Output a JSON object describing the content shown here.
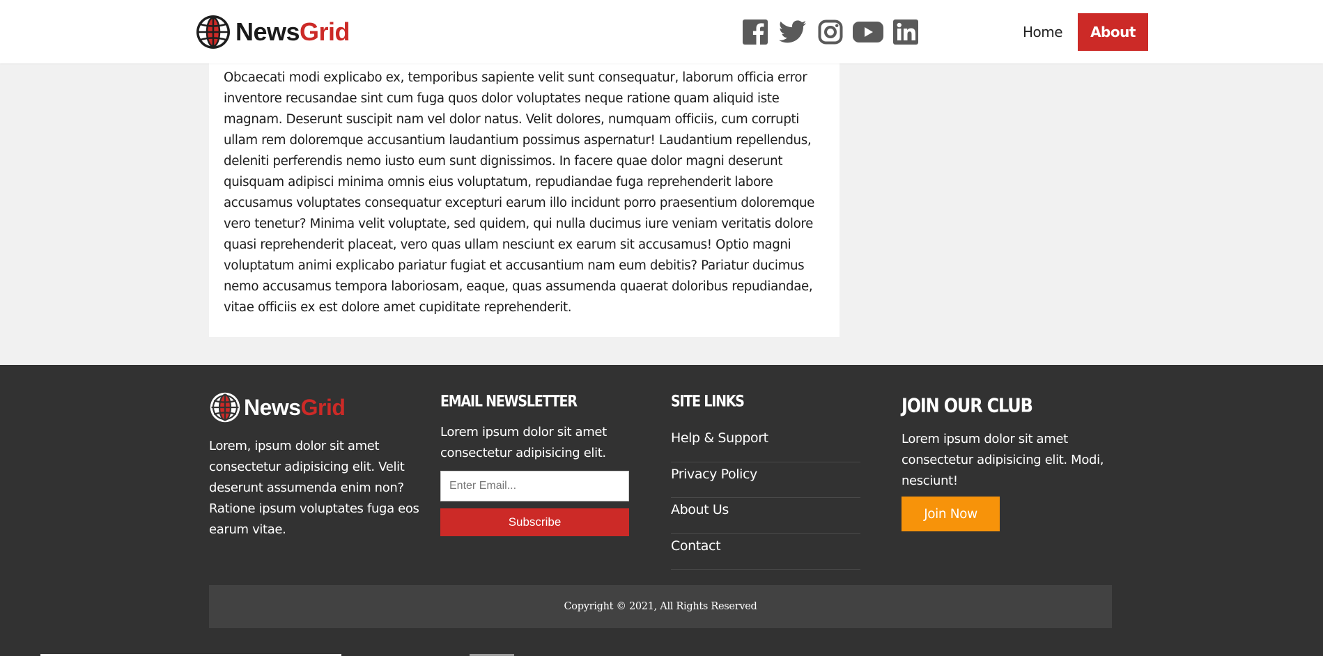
{
  "brand": {
    "name_part1": "News",
    "name_part2": "Grid",
    "accent_color": "#cc2a27"
  },
  "header": {
    "social_icons": [
      "facebook-icon",
      "twitter-icon",
      "instagram-icon",
      "youtube-icon",
      "linkedin-icon"
    ],
    "nav": {
      "home_label": "Home",
      "about_label": "About",
      "active": "About"
    }
  },
  "article": {
    "body": "Obcaecati modi explicabo ex, temporibus sapiente velit sunt consequatur, laborum officia error inventore recusandae sint cum fuga quos dolor voluptates neque ratione quam aliquid iste magnam. Deserunt suscipit nam vel dolor natus. Velit dolores, numquam officiis, cum corrupti ullam rem doloremque accusantium laudantium possimus aspernatur! Laudantium repellendus, deleniti perferendis nemo iusto eum sunt dignissimos. In facere quae dolor magni deserunt quisquam adipisci minima omnis eius voluptatum, repudiandae fuga reprehenderit labore accusamus voluptates consequatur excepturi earum illo incidunt porro praesentium doloremque vero tenetur? Minima velit voluptate, sed quidem, qui nulla ducimus iure veniam veritatis dolore quasi reprehenderit placeat, vero quas ullam nesciunt ex earum sit accusamus! Optio magni voluptatum animi explicabo pariatur fugiat et accusantium nam eum debitis? Pariatur ducimus nemo accusamus tempora laboriosam, eaque, quas assumenda quaerat doloribus repudiandae, vitae officiis ex est dolore amet cupiditate reprehenderit."
  },
  "footer": {
    "about_text": "Lorem, ipsum dolor sit amet consectetur adipisicing elit. Velit deserunt assumenda enim non? Ratione ipsum voluptates fuga eos earum vitae.",
    "newsletter": {
      "heading": "Email Newsletter",
      "text": "Lorem ipsum dolor sit amet consectetur adipisicing elit.",
      "email_placeholder": "Enter Email...",
      "email_value": "",
      "subscribe_label": "Subscribe"
    },
    "site_links": {
      "heading": "Site Links",
      "items": [
        "Help & Support",
        "Privacy Policy",
        "About Us",
        "Contact"
      ]
    },
    "club": {
      "heading": "Join Our Club",
      "text": "Lorem ipsum dolor sit amet consectetur adipisicing elit. Modi, nesciunt!",
      "button_label": "Join Now",
      "button_color": "#f7930a"
    },
    "copyright": "Copyright © 2021, All Rights Reserved"
  }
}
